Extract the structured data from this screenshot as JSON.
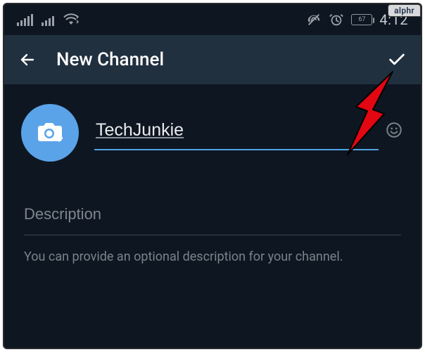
{
  "watermark": "alphr",
  "status": {
    "battery_text": "67",
    "time": "4:12"
  },
  "header": {
    "title": "New Channel"
  },
  "form": {
    "channel_name": "TechJunkie",
    "description_placeholder": "Description",
    "description_hint": "You can provide an optional description for your channel."
  }
}
